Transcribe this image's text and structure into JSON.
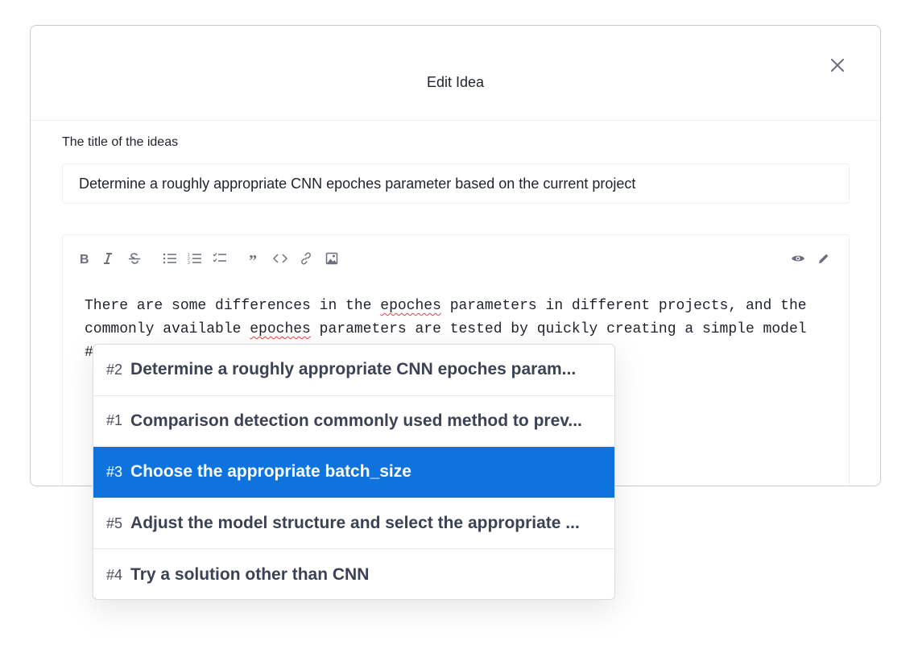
{
  "modal": {
    "title": "Edit Idea",
    "title_field_label": "The title of the ideas",
    "title_value": "Determine a roughly appropriate CNN epoches parameter based on the current project"
  },
  "editor": {
    "toolbar_icons": [
      "bold-icon",
      "italic-icon",
      "strikethrough-icon",
      "bullet-list-icon",
      "ordered-list-icon",
      "task-list-icon",
      "quote-icon",
      "code-icon",
      "link-icon",
      "image-icon",
      "preview-eye-icon",
      "edit-pencil-icon"
    ],
    "text_parts": {
      "a": "There are some differences in the ",
      "b": "epoches",
      "c": " parameters in different projects, and the\ncommonly available ",
      "d": "epoches",
      "e": " parameters are tested by quickly creating a simple model\n#"
    }
  },
  "suggestions": [
    {
      "num": "#2",
      "text": "Determine a roughly appropriate CNN epoches param...",
      "selected": false
    },
    {
      "num": "#1",
      "text": "Comparison detection commonly used method to prev...",
      "selected": false
    },
    {
      "num": "#3",
      "text": "Choose the appropriate batch_size",
      "selected": true
    },
    {
      "num": "#5",
      "text": "Adjust the model structure and select the appropriate ...",
      "selected": false
    },
    {
      "num": "#4",
      "text": "Try a solution other than CNN",
      "selected": false
    }
  ],
  "colors": {
    "accent": "#0f73de",
    "border": "#c9ccd2",
    "text": "#1f2329"
  }
}
